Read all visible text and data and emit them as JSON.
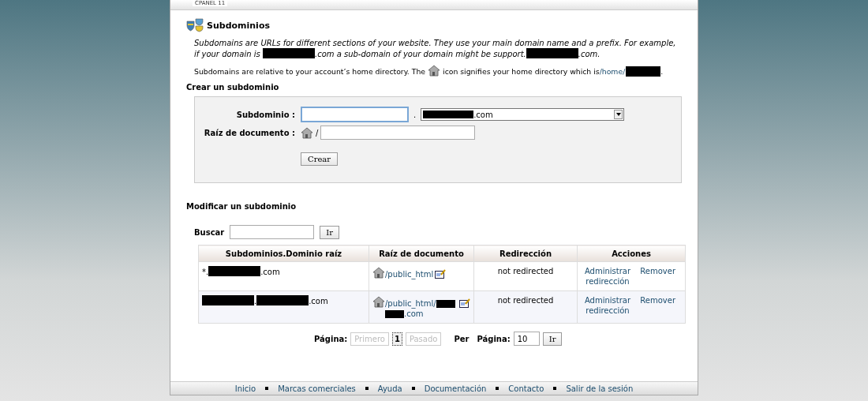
{
  "header": {
    "label": "CPANEL 11"
  },
  "page": {
    "title": "Subdominios",
    "intro": [
      {
        "kind": "text",
        "text": "Subdomains are URLs for different sections of your website. They use your main domain name and a prefix. For example, if your domain is "
      },
      {
        "kind": "redacted"
      },
      {
        "kind": "text",
        "text": ".com a sub-domain of your domain might be support."
      },
      {
        "kind": "redacted"
      },
      {
        "kind": "text",
        "text": ".com."
      }
    ],
    "note": [
      {
        "kind": "text",
        "text": "Subdomains are relative to your account’s home directory. The "
      },
      {
        "kind": "icon"
      },
      {
        "kind": "text",
        "text": " icon signifies your home directory which is "
      },
      {
        "kind": "link",
        "text": "/home/"
      },
      {
        "kind": "redacted"
      },
      {
        "kind": "text",
        "text": "."
      }
    ]
  },
  "create": {
    "heading": "Crear un subdominio",
    "subdomain_label": "Subdominio :",
    "dot": ".",
    "domain_select": [
      {
        "kind": "redacted"
      },
      {
        "kind": "text",
        "text": ".com"
      }
    ],
    "docroot_label": "Raíz de documento :",
    "slash": "/",
    "button": "Crear"
  },
  "modify": {
    "heading": "Modificar un subdominio",
    "search_label": "Buscar",
    "search_button": "Ir",
    "columns": [
      "Subdominios.Dominio raíz",
      "Raíz de documento",
      "Redirección",
      "Acciones"
    ],
    "rows": [
      {
        "subdomain": [
          {
            "kind": "text",
            "text": "*."
          },
          {
            "kind": "redacted"
          },
          {
            "kind": "text",
            "text": ".com"
          }
        ],
        "docroot": [
          {
            "kind": "text",
            "text": "/public_html"
          }
        ],
        "redirection": "not redirected",
        "manage": "Administrar redirección",
        "remove": "Remover"
      },
      {
        "subdomain": [
          {
            "kind": "redacted"
          },
          {
            "kind": "text",
            "text": "."
          },
          {
            "kind": "redacted"
          },
          {
            "kind": "text",
            "text": ".com"
          }
        ],
        "docroot": [
          {
            "kind": "text",
            "text": "/public_html/"
          },
          {
            "kind": "redacted_short"
          },
          {
            "kind": "redacted_short"
          },
          {
            "kind": "text",
            "text": ".com"
          }
        ],
        "redirection": "not redirected",
        "manage": "Administrar redirección",
        "remove": "Remover"
      }
    ]
  },
  "pagination": {
    "label": "Página:",
    "first": {
      "label": "Primero",
      "disabled": true
    },
    "pages": [
      {
        "label": "1",
        "selected": true
      }
    ],
    "last": {
      "label": "Pasado",
      "disabled": true
    },
    "per_label": "Per",
    "per_label2": "Página:",
    "per_value": "10",
    "button": "Ir"
  },
  "footer": [
    "Inicio",
    "Marcas comerciales",
    "Ayuda",
    "Documentación",
    "Contacto",
    "Salir de la sesión"
  ]
}
